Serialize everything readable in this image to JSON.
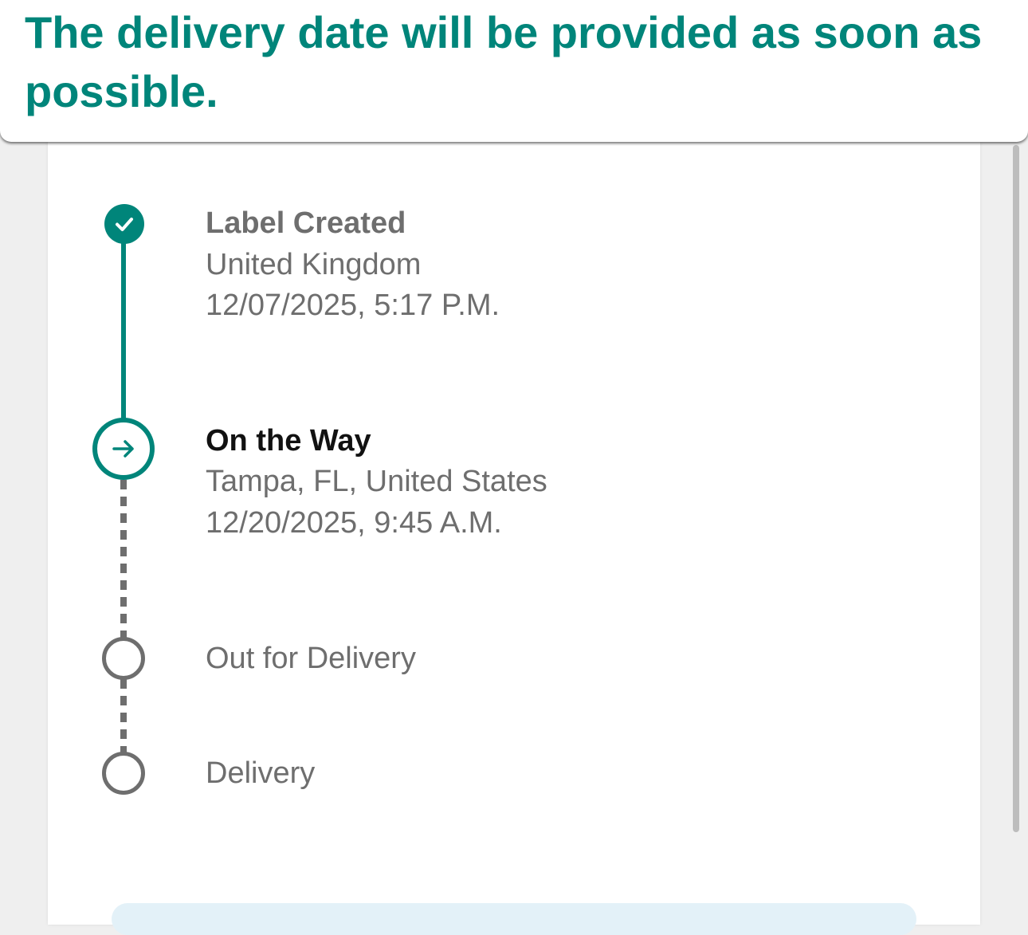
{
  "banner": {
    "message": "The delivery date will be provided as soon as possible."
  },
  "timeline": {
    "steps": [
      {
        "status": "completed",
        "title": "Label Created",
        "location": "United Kingdom",
        "datetime": "12/07/2025, 5:17 P.M.",
        "icon": "check-icon"
      },
      {
        "status": "current",
        "title": "On the Way",
        "location": "Tampa, FL, United States",
        "datetime": "12/20/2025, 9:45 A.M.",
        "icon": "arrow-right-icon"
      },
      {
        "status": "pending",
        "title": "Out for Delivery",
        "icon": "empty-circle-icon"
      },
      {
        "status": "pending",
        "title": "Delivery",
        "icon": "empty-circle-icon"
      }
    ]
  },
  "colors": {
    "accent": "#00857a",
    "muted_text": "#6e6e6e",
    "dark_text": "#111111",
    "page_background": "#efefef"
  }
}
